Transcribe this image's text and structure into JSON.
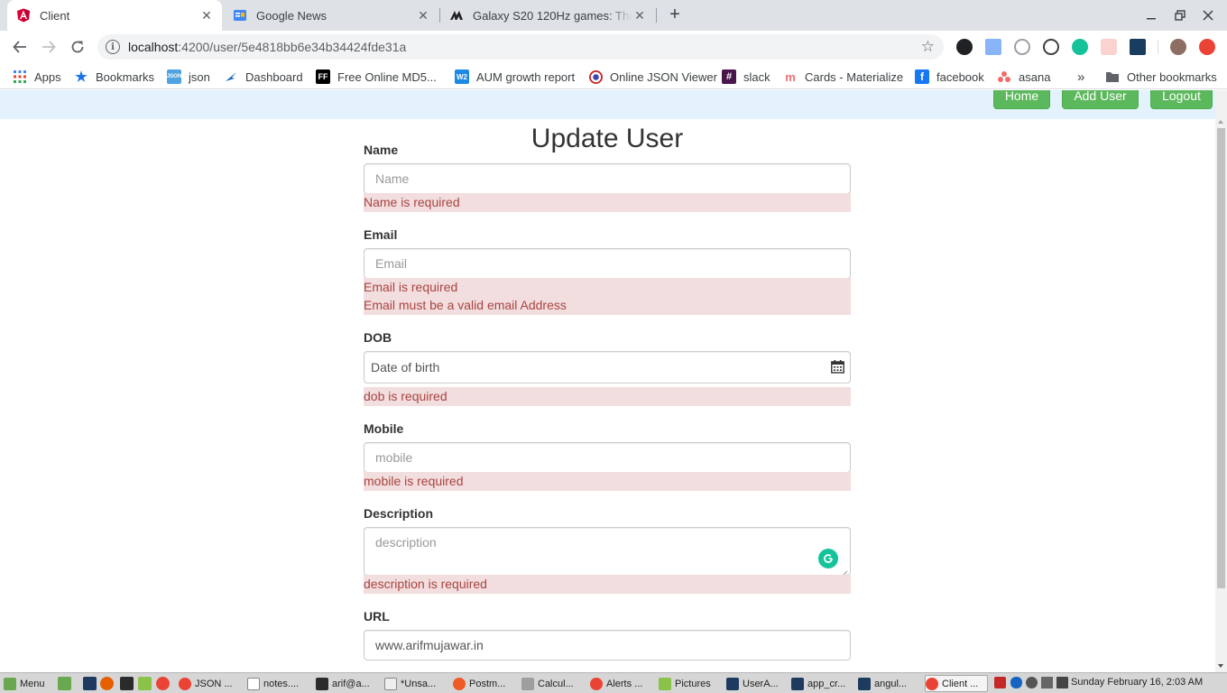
{
  "browser": {
    "tabs": [
      {
        "title": "Client",
        "active": true,
        "icon": "angular-icon"
      },
      {
        "title": "Google News",
        "active": false,
        "icon": "google-news-icon"
      },
      {
        "title": "Galaxy S20 120Hz games: The",
        "active": false,
        "icon": "androidpolice-icon"
      }
    ],
    "url_host": "localhost",
    "url_path": ":4200/user/5e4818bb6e34b34424fde31a"
  },
  "bookmarks": [
    {
      "label": "Apps",
      "icon": "apps-grid-icon"
    },
    {
      "label": "Bookmarks",
      "icon": "star-icon"
    },
    {
      "label": "json",
      "icon": "json-icon"
    },
    {
      "label": "Dashboard",
      "icon": "dashboard-icon"
    },
    {
      "label": "Free Online MD5...",
      "icon": "ff-icon"
    },
    {
      "label": "AUM growth report",
      "icon": "w2-icon"
    },
    {
      "label": "Online JSON Viewer",
      "icon": "json-viewer-icon"
    },
    {
      "label": "slack",
      "icon": "slack-icon"
    },
    {
      "label": "Cards - Materialize",
      "icon": "materialize-icon"
    },
    {
      "label": "facebook",
      "icon": "facebook-icon"
    },
    {
      "label": "asana",
      "icon": "asana-icon"
    },
    {
      "label": "»",
      "icon": "chevron-more-icon"
    },
    {
      "label": "Other bookmarks",
      "icon": "folder-icon"
    }
  ],
  "appnav": {
    "buttons": [
      "Home",
      "Add User",
      "Logout"
    ]
  },
  "form": {
    "title": "Update User",
    "name": {
      "label": "Name",
      "placeholder": "Name",
      "errors": [
        "Name is required"
      ]
    },
    "email": {
      "label": "Email",
      "placeholder": "Email",
      "errors": [
        "Email is required",
        "Email must be a valid email Address"
      ]
    },
    "dob": {
      "label": "DOB",
      "placeholder": "Date of birth",
      "errors": [
        "dob is required"
      ]
    },
    "mobile": {
      "label": "Mobile",
      "placeholder": "mobile",
      "errors": [
        "mobile is required"
      ]
    },
    "description": {
      "label": "Description",
      "placeholder": "description",
      "errors": [
        "description is required"
      ]
    },
    "url": {
      "label": "URL",
      "value": "www.arifmujawar.in"
    }
  },
  "taskbar": {
    "menu_label": "Menu",
    "windows": [
      "JSON ...",
      "notes....",
      "arif@a...",
      "*Unsa...",
      "Postm...",
      "Calcul...",
      "Alerts ...",
      "Pictures",
      "UserA...",
      "app_cr...",
      "angul...",
      "Client ..."
    ],
    "clock": "Sunday February 16,  2:03 AM"
  },
  "colors": {
    "success": "#5cb85c",
    "error_bg": "#f2dede",
    "error_text": "#a94442",
    "nav_bg": "#e3f2fd"
  }
}
